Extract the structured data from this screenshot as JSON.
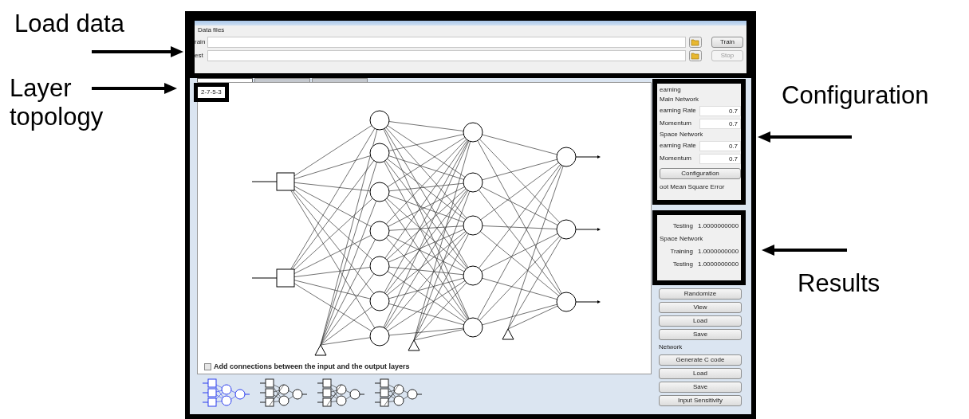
{
  "annotations": [
    {
      "text": "Load data"
    },
    {
      "text": "Layer topology"
    },
    {
      "text": "Configuration"
    },
    {
      "text": "Results"
    }
  ],
  "data_files": {
    "title": "Data files",
    "rows": [
      {
        "label": "rain",
        "button": "Train",
        "disabled": false
      },
      {
        "label": "est",
        "button": "Stop",
        "disabled": true
      }
    ]
  },
  "tabs": [
    {
      "selected": true
    },
    {
      "selected": false
    },
    {
      "selected": false
    }
  ],
  "topology_label": "2-7-5-3",
  "connect_checkbox": {
    "label": "Add connections between the input and the output layers",
    "checked": false
  },
  "topologies": [
    {
      "selected": true
    },
    {
      "selected": false
    },
    {
      "selected": false
    },
    {
      "selected": false
    }
  ],
  "learning": {
    "title": "earning",
    "groups": [
      {
        "title": "Main Network",
        "fields": [
          {
            "label": "earning Rate",
            "value": "0.7"
          },
          {
            "label": "Momentum",
            "value": "0.7"
          }
        ]
      },
      {
        "title": "Space Network",
        "fields": [
          {
            "label": "earning Rate",
            "value": "0.7"
          },
          {
            "label": "Momentum",
            "value": "0.7"
          }
        ]
      }
    ],
    "button": "Configuration",
    "error_title": "oot Mean Square Error"
  },
  "results": [
    {
      "kind": "value",
      "label": "Testing",
      "value": "1.0000000000"
    },
    {
      "kind": "heading",
      "label": "Space Network"
    },
    {
      "kind": "value",
      "label": "Training",
      "value": "1.0000000000"
    },
    {
      "kind": "value",
      "label": "Testing",
      "value": "1.0000000000"
    }
  ],
  "weights_buttons": [
    "Randomize",
    "View",
    "Load",
    "Save"
  ],
  "network": {
    "title": "Network",
    "buttons": [
      "Generate C code",
      "Load",
      "Save",
      "Input Sensitivity"
    ]
  }
}
